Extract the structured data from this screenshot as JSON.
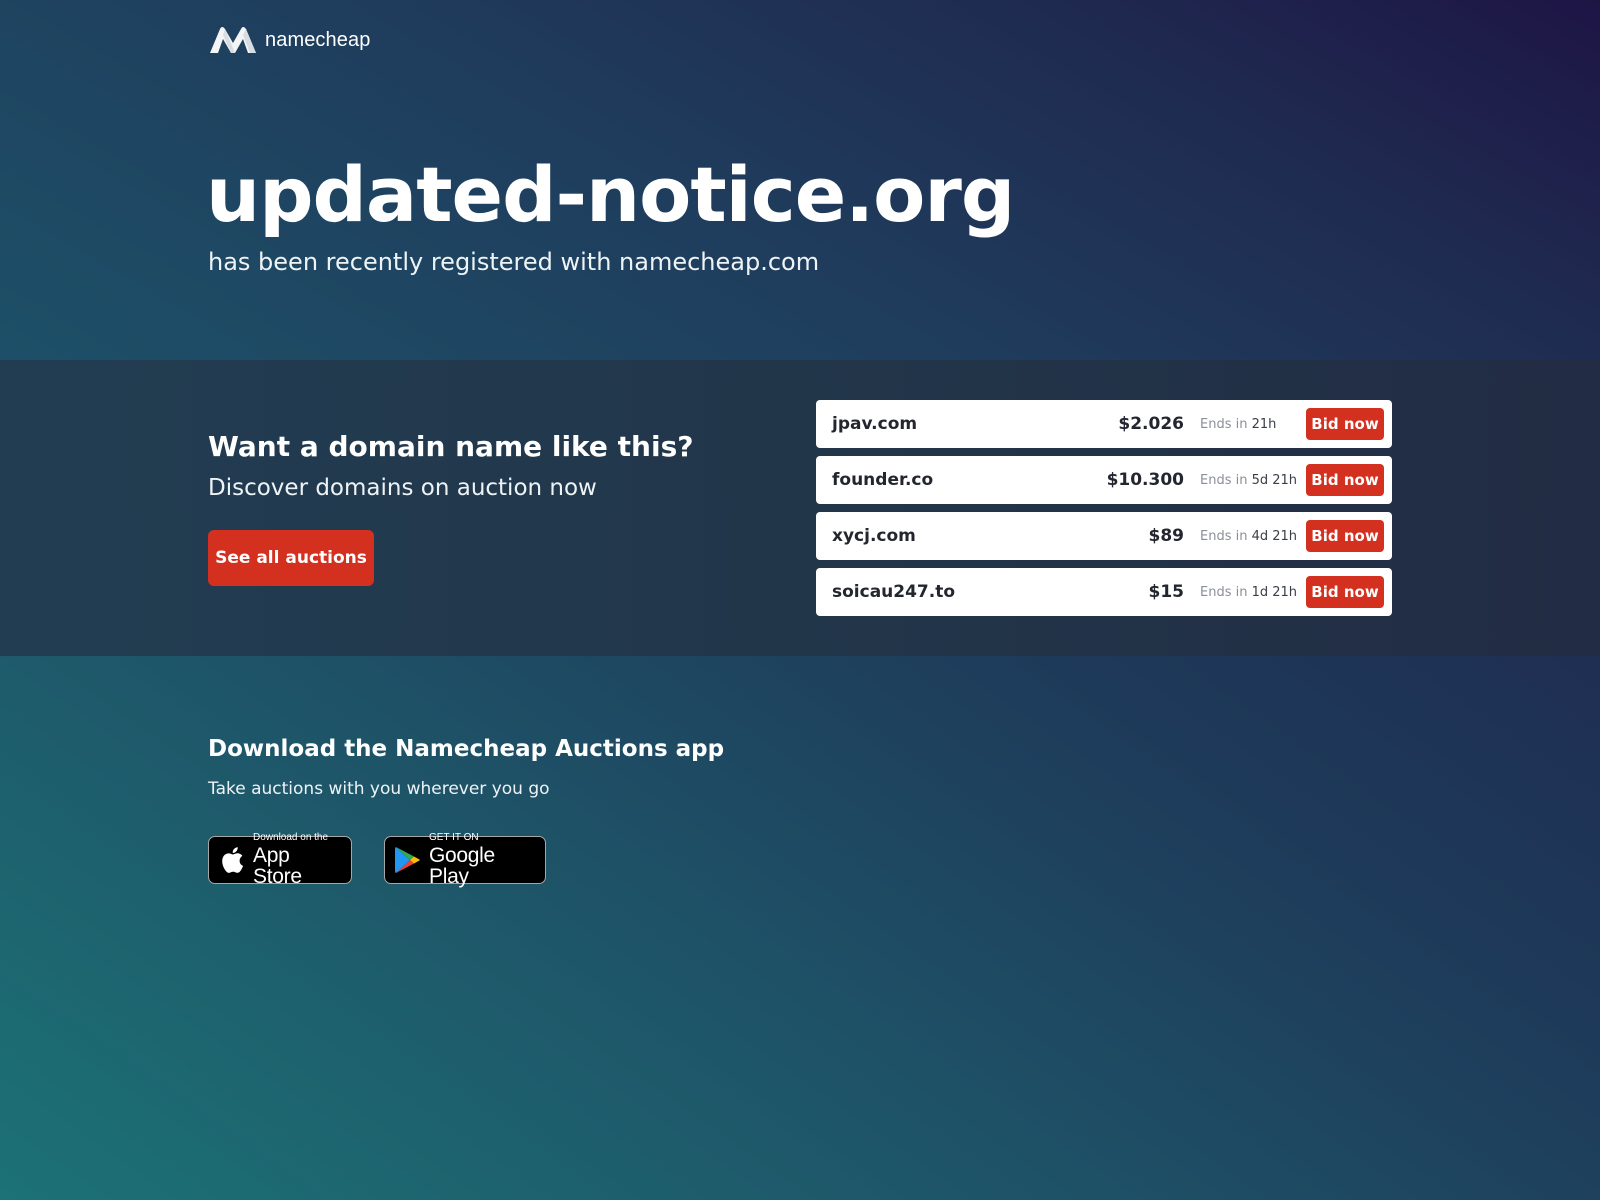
{
  "brand": {
    "name": "namecheap",
    "logo_icon": "namecheap-logo-icon"
  },
  "hero": {
    "domain": "updated-notice.org",
    "subtitle": "has been recently registered with namecheap.com"
  },
  "auctions": {
    "title": "Want a domain name like this?",
    "subtitle": "Discover domains on auction now",
    "see_all_label": "See all auctions",
    "ends_prefix": "Ends in",
    "bid_label": "Bid now",
    "items": [
      {
        "name": "jpav.com",
        "price": "$2.026",
        "ends": "21h"
      },
      {
        "name": "founder.co",
        "price": "$10.300",
        "ends": "5d 21h"
      },
      {
        "name": "xycj.com",
        "price": "$89",
        "ends": "4d 21h"
      },
      {
        "name": "soicau247.to",
        "price": "$15",
        "ends": "1d 21h"
      }
    ]
  },
  "app": {
    "title": "Download the Namecheap Auctions app",
    "subtitle": "Take auctions with you wherever you go",
    "appstore_small": "Download on the",
    "appstore_large": "App Store",
    "googleplay_small": "GET IT ON",
    "googleplay_large": "Google Play"
  },
  "colors": {
    "accent": "#d3301f",
    "text_dark": "#23262f"
  }
}
